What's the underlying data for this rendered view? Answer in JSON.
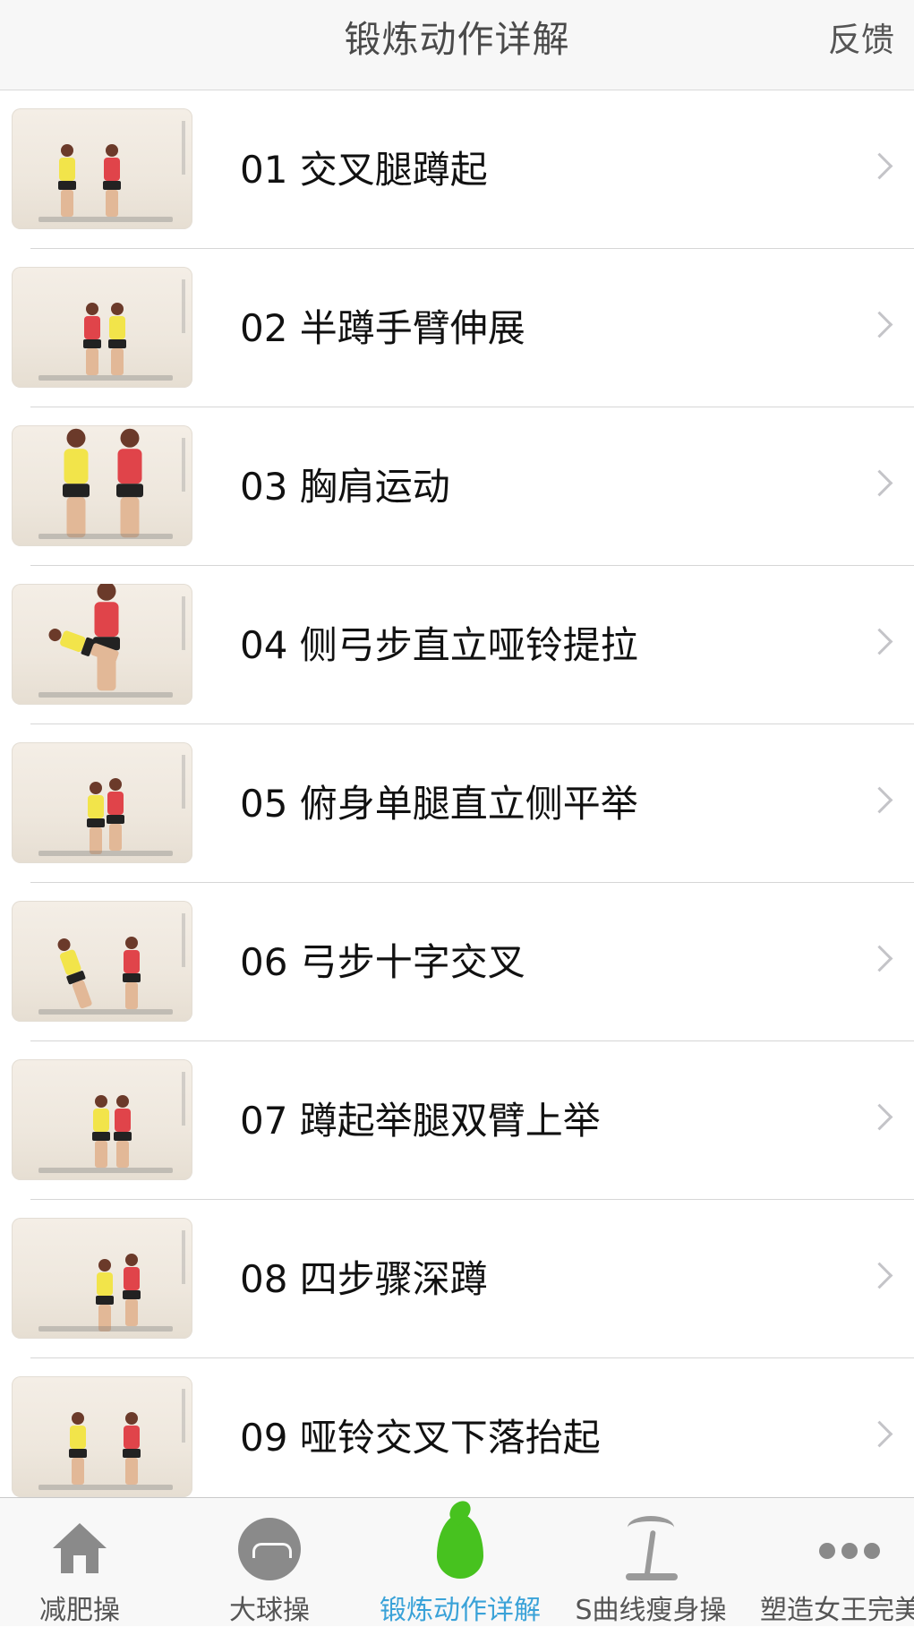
{
  "navbar": {
    "title": "锻炼动作详解",
    "action": "反馈"
  },
  "items": [
    {
      "label": "01 交叉腿蹲起"
    },
    {
      "label": "02 半蹲手臂伸展"
    },
    {
      "label": "03 胸肩运动"
    },
    {
      "label": "04 侧弓步直立哑铃提拉"
    },
    {
      "label": "05 俯身单腿直立侧平举"
    },
    {
      "label": "06 弓步十字交叉"
    },
    {
      "label": "07 蹲起举腿双臂上举"
    },
    {
      "label": "08 四步骤深蹲"
    },
    {
      "label": "09 哑铃交叉下落抬起"
    }
  ],
  "tabs": [
    {
      "label": "减肥操",
      "icon": "home-icon",
      "active": false
    },
    {
      "label": "大球操",
      "icon": "ball-icon",
      "active": false
    },
    {
      "label": "锻炼动作详解",
      "icon": "flame-icon",
      "active": true
    },
    {
      "label": "S曲线瘦身操",
      "icon": "palm-tree-icon",
      "active": false
    },
    {
      "label": "塑造女王完美",
      "icon": "more-icon",
      "active": false
    }
  ],
  "colors": {
    "active_tab": "#3aa2d8",
    "inactive_tab": "#555555",
    "flame": "#47c21f"
  }
}
